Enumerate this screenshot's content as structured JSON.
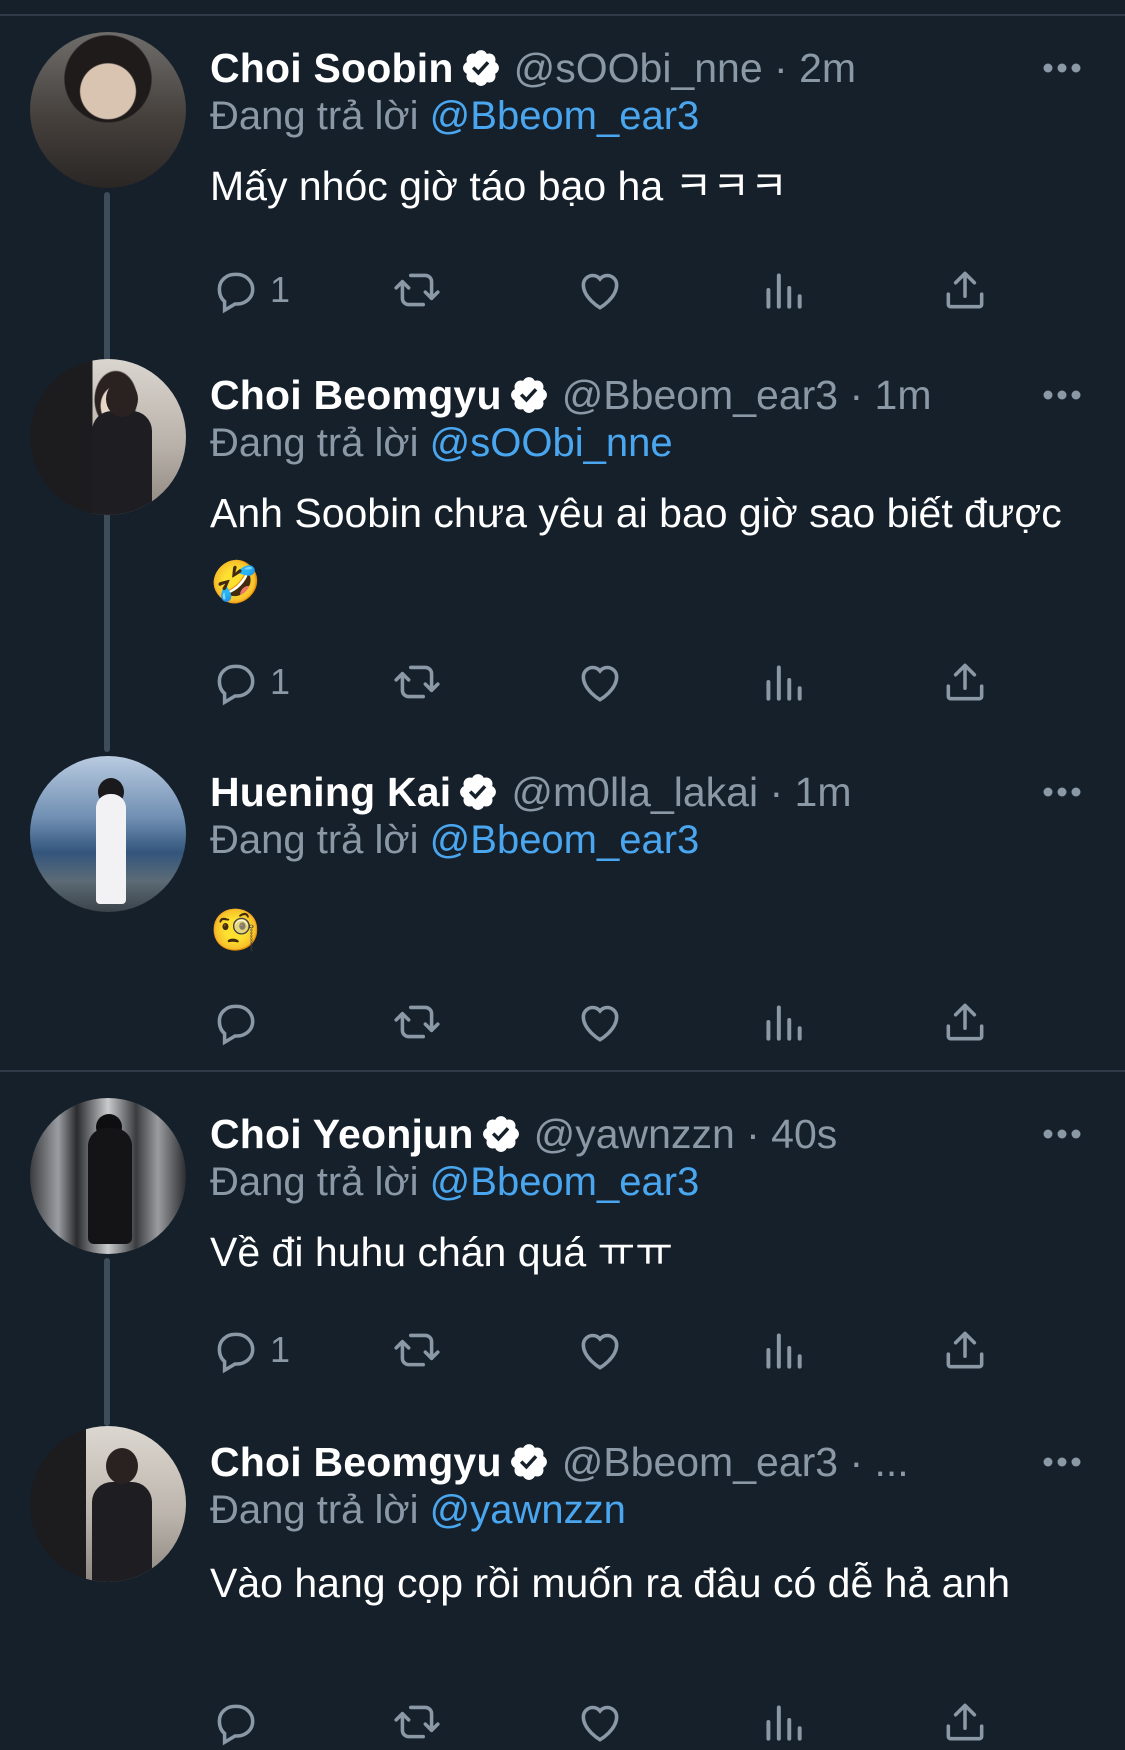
{
  "reply_prefix": "Đang trả lời ",
  "tweets": [
    {
      "name": "Choi Soobin",
      "handle_time": "@sOObi_nne · 2m",
      "reply_to": "@Bbeom_ear3",
      "text": "Mấy nhóc giờ táo bạo ha ㅋㅋㅋ",
      "reply_count": "1"
    },
    {
      "name": "Choi Beomgyu",
      "handle_time": "@Bbeom_ear3 · 1m",
      "reply_to": "@sOObi_nne",
      "text": "Anh Soobin chưa yêu ai bao giờ sao biết được 🤣",
      "reply_count": "1"
    },
    {
      "name": "Huening Kai",
      "handle_time": "@m0lla_lakai · 1m",
      "reply_to": "@Bbeom_ear3",
      "text": "🧐",
      "reply_count": ""
    },
    {
      "name": "Choi Yeonjun",
      "handle_time": "@yawnzzn · 40s",
      "reply_to": "@Bbeom_ear3",
      "text": "Về đi huhu chán quá ㅠㅠ",
      "reply_count": "1"
    },
    {
      "name": "Choi Beomgyu",
      "handle_time": "@Bbeom_ear3 · ...",
      "reply_to": "@yawnzzn",
      "text": "Vào hang cọp rồi muốn ra đâu có dễ hả anh",
      "reply_count": ""
    }
  ],
  "icons": {
    "verified": "verified-badge-icon",
    "more": "more-options-icon",
    "reply": "reply-icon",
    "retweet": "retweet-icon",
    "like": "like-icon",
    "views": "views-icon",
    "share": "share-icon"
  },
  "colors": {
    "background": "#15202b",
    "secondary_text": "#8b98a5",
    "mention": "#4aa6ef",
    "divider": "#2f3b48"
  }
}
